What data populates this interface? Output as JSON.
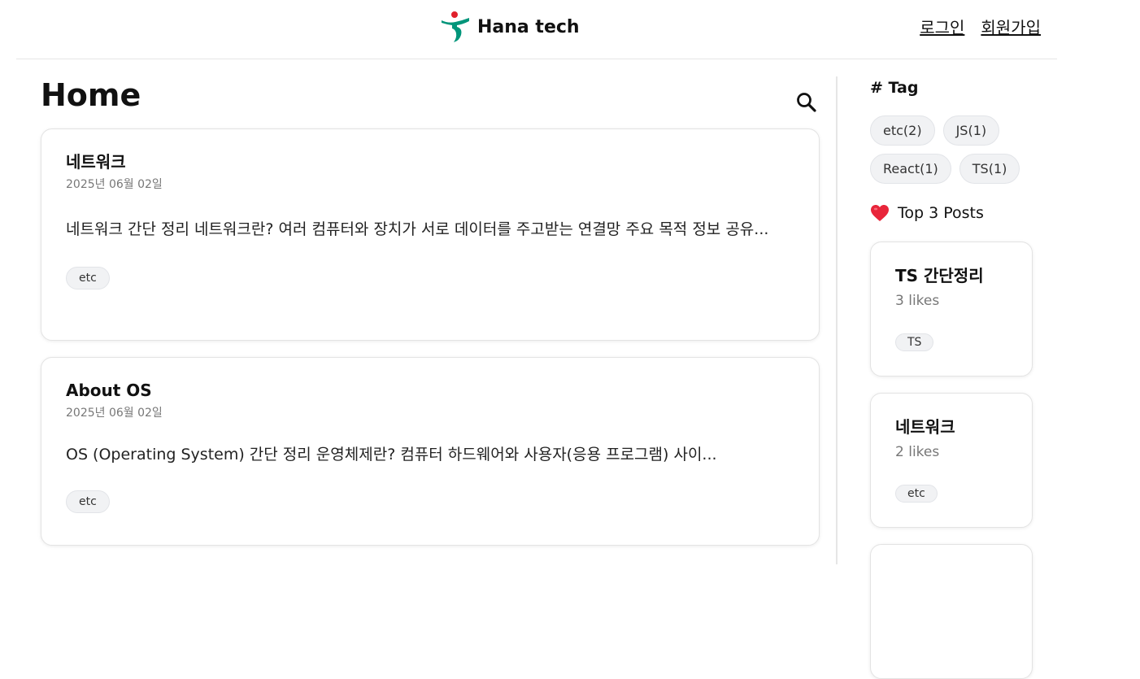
{
  "header": {
    "brand_name": "Hana tech",
    "login_label": "로그인",
    "signup_label": "회원가입"
  },
  "main": {
    "title": "Home",
    "posts": [
      {
        "title": "네트워크",
        "date": "2025년 06월 02일",
        "excerpt": "네트워크 간단 정리 네트워크란? 여러 컴퓨터와 장치가 서로 데이터를 주고받는 연결망 주요 목적 정보 공유...",
        "tag": "etc"
      },
      {
        "title": "About OS",
        "date": "2025년 06월 02일",
        "excerpt": "OS (Operating System) 간단 정리 운영체제란? 컴퓨터 하드웨어와 사용자(응용 프로그램) 사이...",
        "tag": "etc"
      }
    ]
  },
  "sidebar": {
    "tag_heading": "# Tag",
    "tags": [
      "etc(2)",
      "JS(1)",
      "React(1)",
      "TS(1)"
    ],
    "top_heading": "Top 3 Posts",
    "top_posts": [
      {
        "title": "TS 간단정리",
        "likes": "3 likes",
        "tag": "TS"
      },
      {
        "title": "네트워크",
        "likes": "2 likes",
        "tag": "etc"
      },
      {
        "title": "",
        "likes": "",
        "tag": ""
      }
    ]
  },
  "colors": {
    "logo_green": "#00957a",
    "logo_red": "#e0202b",
    "heart_red": "#e8253a",
    "divider": "#e6e6e6",
    "chip_bg": "#f1f2f4"
  },
  "icons": {
    "logo": "hana-logo-icon",
    "search": "search-icon",
    "heart": "heart-icon"
  }
}
